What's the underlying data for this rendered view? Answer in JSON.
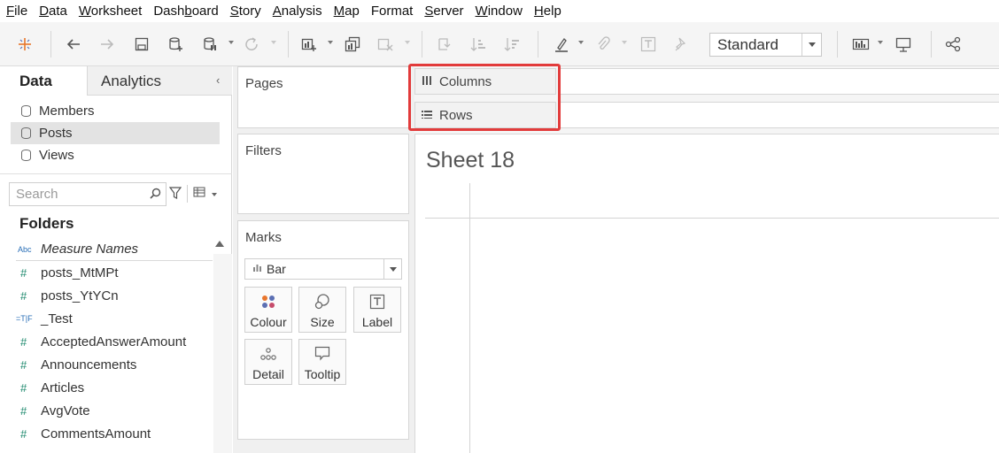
{
  "menu": [
    {
      "pre": "",
      "u": "F",
      "post": "ile"
    },
    {
      "pre": "",
      "u": "D",
      "post": "ata"
    },
    {
      "pre": "",
      "u": "W",
      "post": "orksheet"
    },
    {
      "pre": "Dash",
      "u": "b",
      "post": "oard"
    },
    {
      "pre": "",
      "u": "S",
      "post": "tory"
    },
    {
      "pre": "",
      "u": "A",
      "post": "nalysis"
    },
    {
      "pre": "",
      "u": "M",
      "post": "ap"
    },
    {
      "pre": "Format",
      "u": "",
      "post": ""
    },
    {
      "pre": "",
      "u": "S",
      "post": "erver"
    },
    {
      "pre": "",
      "u": "W",
      "post": "indow"
    },
    {
      "pre": "",
      "u": "H",
      "post": "elp"
    }
  ],
  "toolbar": {
    "fit_mode": "Standard"
  },
  "data_pane": {
    "tab_data": "Data",
    "tab_analytics": "Analytics",
    "collapse_glyph": "‹",
    "datasources": [
      "Members",
      "Posts",
      "Views"
    ],
    "selected_datasource": "Posts",
    "search_placeholder": "Search",
    "folders_title": "Folders",
    "fields": [
      {
        "icon": "Abc",
        "name": "Measure Names",
        "type": "abc"
      },
      {
        "icon": "#",
        "name": "posts_MtMPt",
        "type": "num"
      },
      {
        "icon": "#",
        "name": "posts_YtYCn",
        "type": "num"
      },
      {
        "icon": "=T|F",
        "name": "_Test",
        "type": "bool"
      },
      {
        "icon": "#",
        "name": "AcceptedAnswerAmount",
        "type": "num"
      },
      {
        "icon": "#",
        "name": "Announcements",
        "type": "num"
      },
      {
        "icon": "#",
        "name": "Articles",
        "type": "num"
      },
      {
        "icon": "#",
        "name": "AvgVote",
        "type": "num"
      },
      {
        "icon": "#",
        "name": "CommentsAmount",
        "type": "num"
      }
    ]
  },
  "cards": {
    "pages": "Pages",
    "filters": "Filters",
    "marks": "Marks",
    "mark_type": "Bar",
    "mark_buttons": [
      "Colour",
      "Size",
      "Label",
      "Detail",
      "Tooltip"
    ]
  },
  "shelves": {
    "columns": "Columns",
    "rows": "Rows"
  },
  "sheet": {
    "title": "Sheet 18"
  },
  "colors": {
    "highlight": "#e23b3b",
    "accent_field": "#1f8a6e"
  }
}
